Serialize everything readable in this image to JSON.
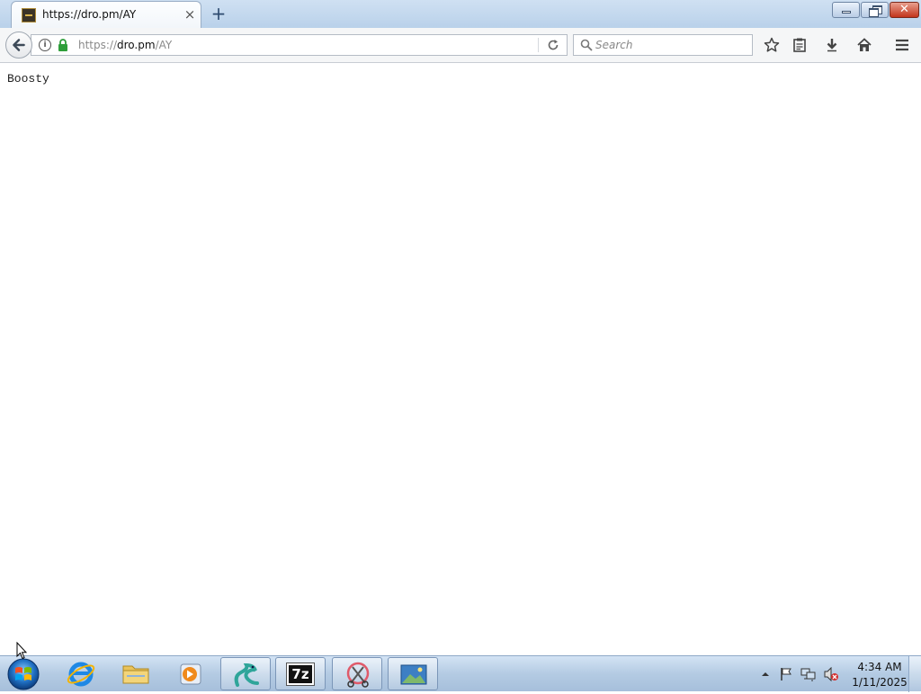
{
  "browser": {
    "tab": {
      "title": "https://dro.pm/AY",
      "close_label": "×"
    },
    "new_tab_label": "+",
    "urlbar": {
      "scheme": "https://",
      "host": "dro.pm",
      "path": "/AY"
    },
    "search": {
      "placeholder": "Search"
    },
    "toolbar_icons": [
      "bookmark-star-icon",
      "reading-list-icon",
      "downloads-icon",
      "home-icon",
      "menu-icon"
    ],
    "window_controls": [
      "minimize",
      "maximize",
      "close"
    ]
  },
  "page": {
    "text": "Boosty"
  },
  "taskbar": {
    "apps": [
      {
        "name": "internet-explorer-icon",
        "open": false
      },
      {
        "name": "file-explorer-icon",
        "open": false
      },
      {
        "name": "media-player-icon",
        "open": false
      },
      {
        "name": "snake-app-icon",
        "open": true
      },
      {
        "name": "7zip-icon",
        "open": true,
        "label": "7z"
      },
      {
        "name": "snipping-tool-icon",
        "open": true
      },
      {
        "name": "image-viewer-icon",
        "open": true
      }
    ],
    "clock": {
      "time": "4:34 AM",
      "date": "1/11/2025"
    }
  },
  "colors": {
    "accent": "#3a78c3",
    "lock_green": "#2e9e3a",
    "close_red": "#c2341b"
  }
}
